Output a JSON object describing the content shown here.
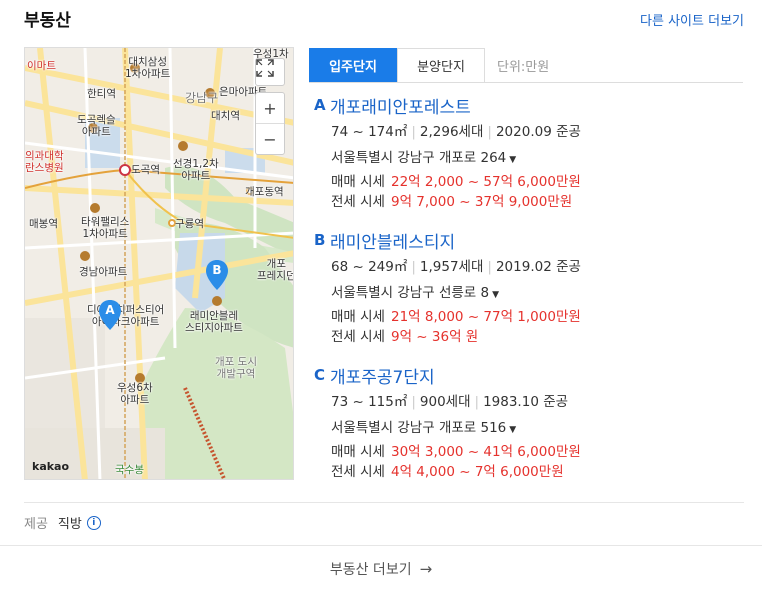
{
  "header": {
    "title": "부동산",
    "more_sites": "다른 사이트 더보기"
  },
  "map": {
    "labels": {
      "emart": "이마트",
      "daechi_samsung": "대치삼성\n1차아파트",
      "woosung1": "우성1차",
      "hanti": "한티역",
      "gangnamgu": "강남구",
      "eunma": "은마아파트",
      "dogok_rexle": "도곡렉슬\n아파트",
      "daechi_station": "대치역",
      "uigwa": "의과대학\n란스병원",
      "dogok_station": "도곡역",
      "seongyeong": "선경1,2차\n아파트",
      "gaepo_station": "개포동역",
      "maebong": "매봉역",
      "tower_palace": "타워팰리스\n1차아파트",
      "guryong": "구룡역",
      "gyeongnam": "경남아파트",
      "gaepo_presige": "개포\n프레지던",
      "dchi_first": "디에이치퍼스티어\n아이파크아파트",
      "raemian_bl": "래미안블레\n스티지아파트",
      "gaepo_dev": "개포 도시\n개발구역",
      "woosung6": "우성6차\n아파트",
      "guksubong": "국수봉",
      "kakao": "kakao"
    },
    "zoom_in": "+",
    "zoom_out": "−",
    "pins": [
      {
        "letter": "A"
      },
      {
        "letter": "B"
      }
    ]
  },
  "tabs": [
    {
      "label": "입주단지",
      "active": true
    },
    {
      "label": "분양단지",
      "active": false
    }
  ],
  "unit_label": "단위:만원",
  "complexes": [
    {
      "letter": "A",
      "name": "개포래미안포레스트",
      "area": "74 ~ 174㎡",
      "households": "2,296세대",
      "completed": "2020.09 준공",
      "address": "서울특별시 강남구 개포로 264",
      "sale_label": "매매 시세",
      "sale": "22억 2,000 ~ 57억 6,000만원",
      "lease_label": "전세 시세",
      "lease": "9억 7,000 ~ 37억 9,000만원"
    },
    {
      "letter": "B",
      "name": "래미안블레스티지",
      "area": "68 ~ 249㎡",
      "households": "1,957세대",
      "completed": "2019.02 준공",
      "address": "서울특별시 강남구 선릉로 8",
      "sale_label": "매매 시세",
      "sale": "21억 8,000 ~ 77억 1,000만원",
      "lease_label": "전세 시세",
      "lease": "9억 ~ 36억 원"
    },
    {
      "letter": "C",
      "name": "개포주공7단지",
      "area": "73 ~ 115㎡",
      "households": "900세대",
      "completed": "1983.10 준공",
      "address": "서울특별시 강남구 개포로 516",
      "sale_label": "매매 시세",
      "sale": "30억 3,000 ~ 41억 6,000만원",
      "lease_label": "전세 시세",
      "lease": "4억 4,000 ~ 7억 6,000만원"
    }
  ],
  "provider": {
    "label": "제공",
    "name": "직방",
    "info_icon": "i"
  },
  "footer": {
    "more": "부동산 더보기",
    "arrow": "→"
  },
  "colors": {
    "accent": "#1a7ce8",
    "link": "#1a64c8",
    "price": "#e5322d",
    "pin": "#2b8de8"
  }
}
